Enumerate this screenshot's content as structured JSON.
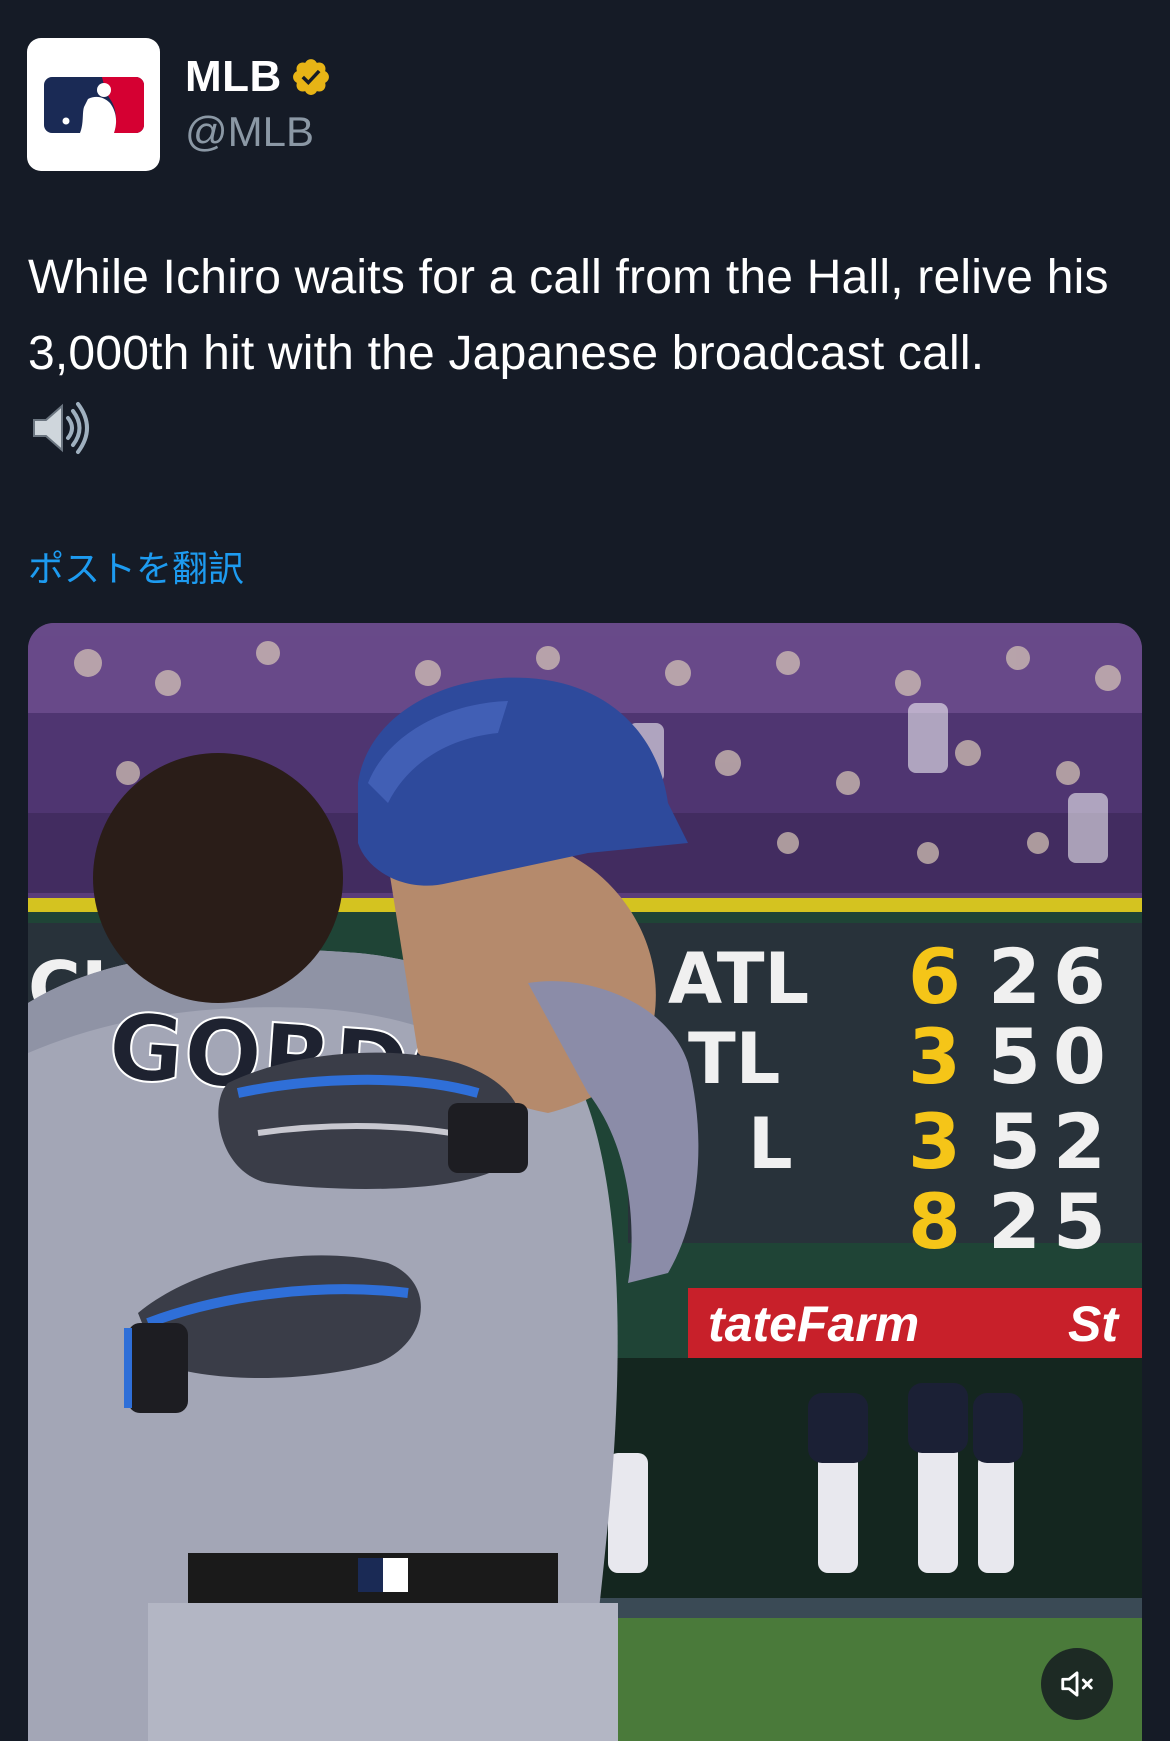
{
  "author": {
    "display_name": "MLB",
    "handle": "@MLB",
    "avatar_icon": "mlb-logo-icon",
    "verified_icon": "verified-badge-icon",
    "verified_color": "#e7b416"
  },
  "post": {
    "text": "While Ichiro waits for a call from the Hall, relive his 3,000th hit with the Japanese broadcast call.",
    "emoji_icon": "speaker-high-volume-icon",
    "translate_label": "ポストを翻訳"
  },
  "video": {
    "jersey_name": "GORDON",
    "scoreboard": {
      "left_fragment": "CI",
      "rows": [
        {
          "team": "ATL",
          "score": "6",
          "a": "2",
          "b": "6"
        },
        {
          "team": "TL",
          "score": "3",
          "a": "5",
          "b": "0"
        },
        {
          "team": "L",
          "score": "3",
          "a": "5",
          "b": "2"
        },
        {
          "team": "",
          "score": "8",
          "a": "2",
          "b": "5"
        }
      ]
    },
    "ad_text_left": "tateFarm",
    "ad_text_right": "St",
    "mute_icon": "speaker-muted-icon"
  },
  "colors": {
    "background": "#151b26",
    "link": "#1d9bf0",
    "handle": "#8b98a5"
  }
}
